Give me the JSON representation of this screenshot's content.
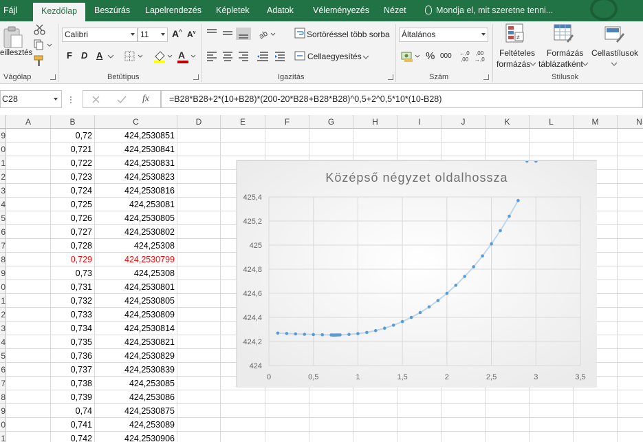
{
  "ribbon_tabs": [
    {
      "label": "Fájl",
      "active": false
    },
    {
      "label": "Kezdőlap",
      "active": true
    },
    {
      "label": "Beszúrás",
      "active": false
    },
    {
      "label": "Lapelrendezés",
      "active": false
    },
    {
      "label": "Képletek",
      "active": false
    },
    {
      "label": "Adatok",
      "active": false
    },
    {
      "label": "Véleményezés",
      "active": false
    },
    {
      "label": "Nézet",
      "active": false
    }
  ],
  "tell_me": "Mondja el, mit szeretne tenni...",
  "clipboard": {
    "paste_label": "eillesztés",
    "group": "Vágólap"
  },
  "font": {
    "name": "Calibri",
    "size": "11",
    "bold": "F",
    "italic": "D",
    "underline": "A",
    "group": "Betűtípus"
  },
  "alignment": {
    "wrap_text": "Sortöréssel több sorba",
    "merge": "Cellaegyesítés",
    "group": "Igazítás"
  },
  "number": {
    "format": "Általános",
    "percent": "%",
    "thousands": "000",
    "inc_decimal": "+,0\n,00",
    "dec_decimal": ",00\n→,0",
    "group": "Szám"
  },
  "styles": {
    "conditional": [
      "Feltételes",
      "formázás"
    ],
    "table": [
      "Formázás",
      "táblázatként"
    ],
    "cell": [
      "Cellastílusok"
    ],
    "group": "Stílusok"
  },
  "formula_bar": {
    "name_box": "C28",
    "fx": "fx",
    "formula": "=B28*B28+2*(10+B28)*(200-20*B28+B28*B28)^0,5+2^0,5*10*(10-B28)"
  },
  "columns": [
    "A",
    "B",
    "C",
    "D",
    "E",
    "F",
    "G",
    "H",
    "I",
    "J",
    "K",
    "L",
    "M",
    "N"
  ],
  "rows": [
    {
      "num": "9",
      "b": "0,72",
      "c": "424,2530851",
      "red": false
    },
    {
      "num": "0",
      "b": "0,721",
      "c": "424,2530841",
      "red": false
    },
    {
      "num": "1",
      "b": "0,722",
      "c": "424,2530831",
      "red": false
    },
    {
      "num": "2",
      "b": "0,723",
      "c": "424,2530823",
      "red": false
    },
    {
      "num": "3",
      "b": "0,724",
      "c": "424,2530816",
      "red": false
    },
    {
      "num": "4",
      "b": "0,725",
      "c": "424,253081",
      "red": false
    },
    {
      "num": "5",
      "b": "0,726",
      "c": "424,2530805",
      "red": false
    },
    {
      "num": "6",
      "b": "0,727",
      "c": "424,2530802",
      "red": false
    },
    {
      "num": "7",
      "b": "0,728",
      "c": "424,25308",
      "red": false
    },
    {
      "num": "8",
      "b": "0,729",
      "c": "424,2530799",
      "red": true
    },
    {
      "num": "9",
      "b": "0,73",
      "c": "424,25308",
      "red": false
    },
    {
      "num": "0",
      "b": "0,731",
      "c": "424,2530801",
      "red": false
    },
    {
      "num": "1",
      "b": "0,732",
      "c": "424,2530805",
      "red": false
    },
    {
      "num": "2",
      "b": "0,733",
      "c": "424,2530809",
      "red": false
    },
    {
      "num": "3",
      "b": "0,734",
      "c": "424,2530814",
      "red": false
    },
    {
      "num": "4",
      "b": "0,735",
      "c": "424,2530821",
      "red": false
    },
    {
      "num": "5",
      "b": "0,736",
      "c": "424,2530829",
      "red": false
    },
    {
      "num": "6",
      "b": "0,737",
      "c": "424,2530839",
      "red": false
    },
    {
      "num": "7",
      "b": "0,738",
      "c": "424,253085",
      "red": false
    },
    {
      "num": "8",
      "b": "0,739",
      "c": "424,253086",
      "red": false
    },
    {
      "num": "9",
      "b": "0,74",
      "c": "424,2530875",
      "red": false
    },
    {
      "num": "0",
      "b": "0,741",
      "c": "424,253089",
      "red": false
    },
    {
      "num": "1",
      "b": "0,742",
      "c": "424,2530906",
      "red": false
    }
  ],
  "chart_data": {
    "type": "scatter",
    "title": "Középső négyzet oldalhossza",
    "xlim": [
      0,
      3.5
    ],
    "ylim": [
      424,
      425.4
    ],
    "x_ticks": [
      "0",
      "0,5",
      "1",
      "1,5",
      "2",
      "2,5",
      "3",
      "3,5"
    ],
    "y_ticks": [
      "424",
      "424,2",
      "424,4",
      "424,6",
      "424,8",
      "425",
      "425,2",
      "425,4"
    ],
    "grid": true,
    "legend": "none",
    "color": "#5b9bd5",
    "trendline": true,
    "x": [
      0.1,
      0.2,
      0.3,
      0.4,
      0.5,
      0.6,
      0.7,
      0.71,
      0.72,
      0.73,
      0.74,
      0.75,
      0.76,
      0.77,
      0.78,
      0.8,
      0.9,
      1.0,
      1.1,
      1.2,
      1.3,
      1.4,
      1.5,
      1.6,
      1.7,
      1.8,
      1.9,
      2.0,
      2.1,
      2.2,
      2.3,
      2.4,
      2.5,
      2.6,
      2.7,
      2.8,
      2.9,
      3.0
    ],
    "y": [
      424.27,
      424.266,
      424.263,
      424.26,
      424.258,
      424.256,
      424.254,
      424.254,
      424.253,
      424.253,
      424.253,
      424.253,
      424.254,
      424.254,
      424.254,
      424.255,
      424.259,
      424.265,
      424.275,
      424.29,
      424.31,
      424.335,
      424.365,
      424.4,
      424.44,
      424.487,
      424.54,
      424.6,
      424.666,
      424.74,
      424.82,
      424.91,
      425.01,
      425.12,
      425.24,
      425.37
    ]
  }
}
